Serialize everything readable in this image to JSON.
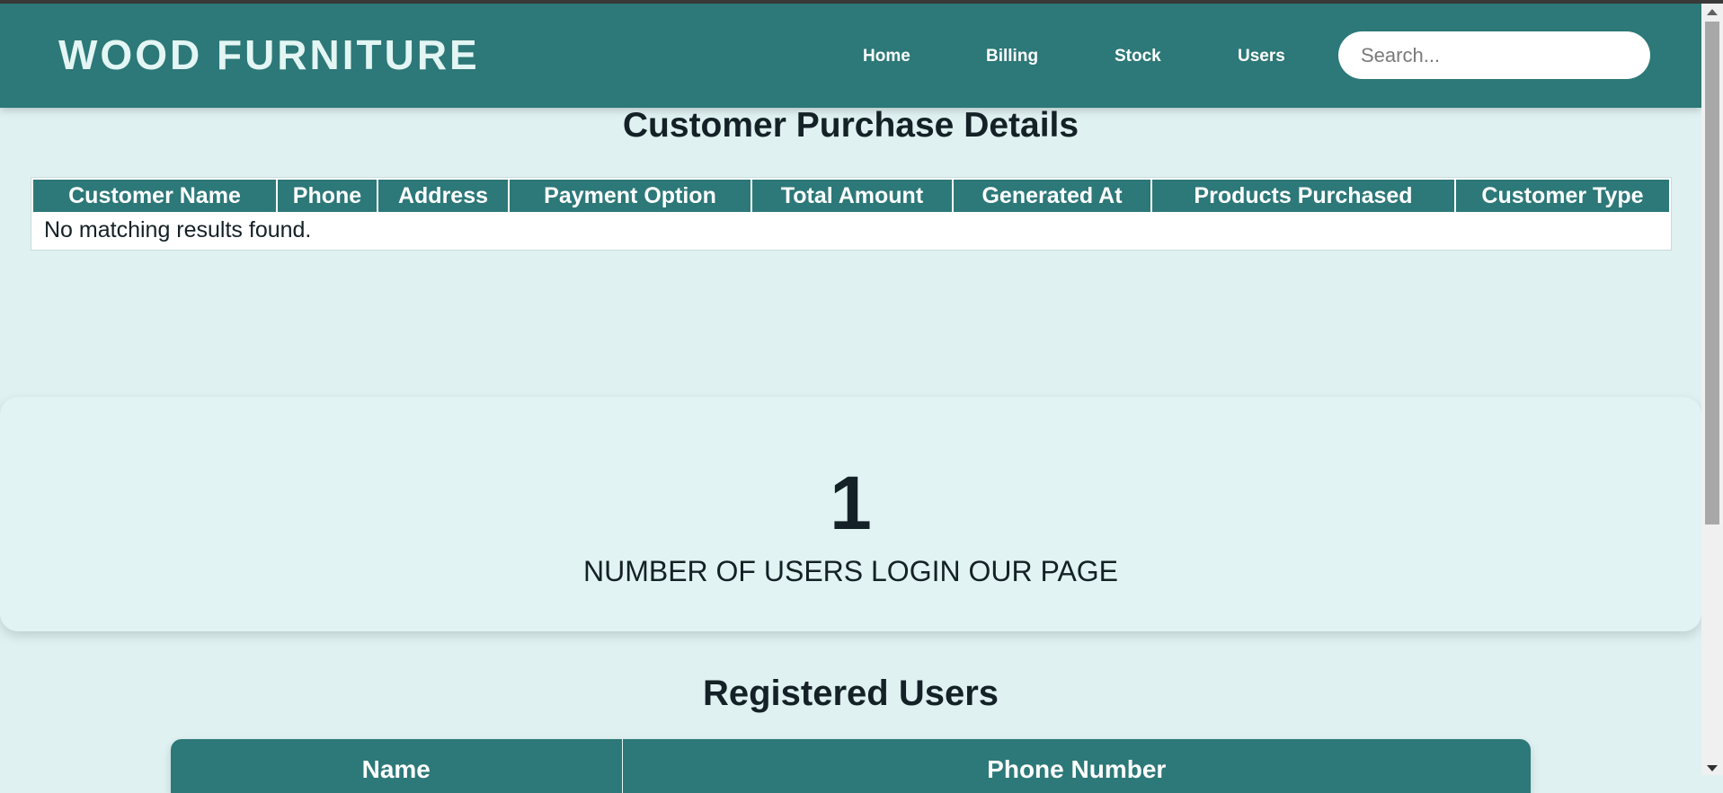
{
  "header": {
    "brand": "WOOD FURNITURE",
    "nav": [
      "Home",
      "Billing",
      "Stock",
      "Users"
    ],
    "search_placeholder": "Search..."
  },
  "purchases": {
    "title": "Customer Purchase Details",
    "columns": [
      "Customer Name",
      "Phone",
      "Address",
      "Payment Option",
      "Total Amount",
      "Generated At",
      "Products Purchased",
      "Customer Type"
    ],
    "empty_message": "No matching results found."
  },
  "stats": {
    "count": "1",
    "label": "NUMBER OF USERS LOGIN OUR PAGE"
  },
  "registered": {
    "title": "Registered Users",
    "columns": [
      "Name",
      "Phone Number"
    ]
  },
  "colors": {
    "navbar": "#2d7878",
    "page_bg": "#dff1f1",
    "brand_text": "#e3f6f4"
  }
}
